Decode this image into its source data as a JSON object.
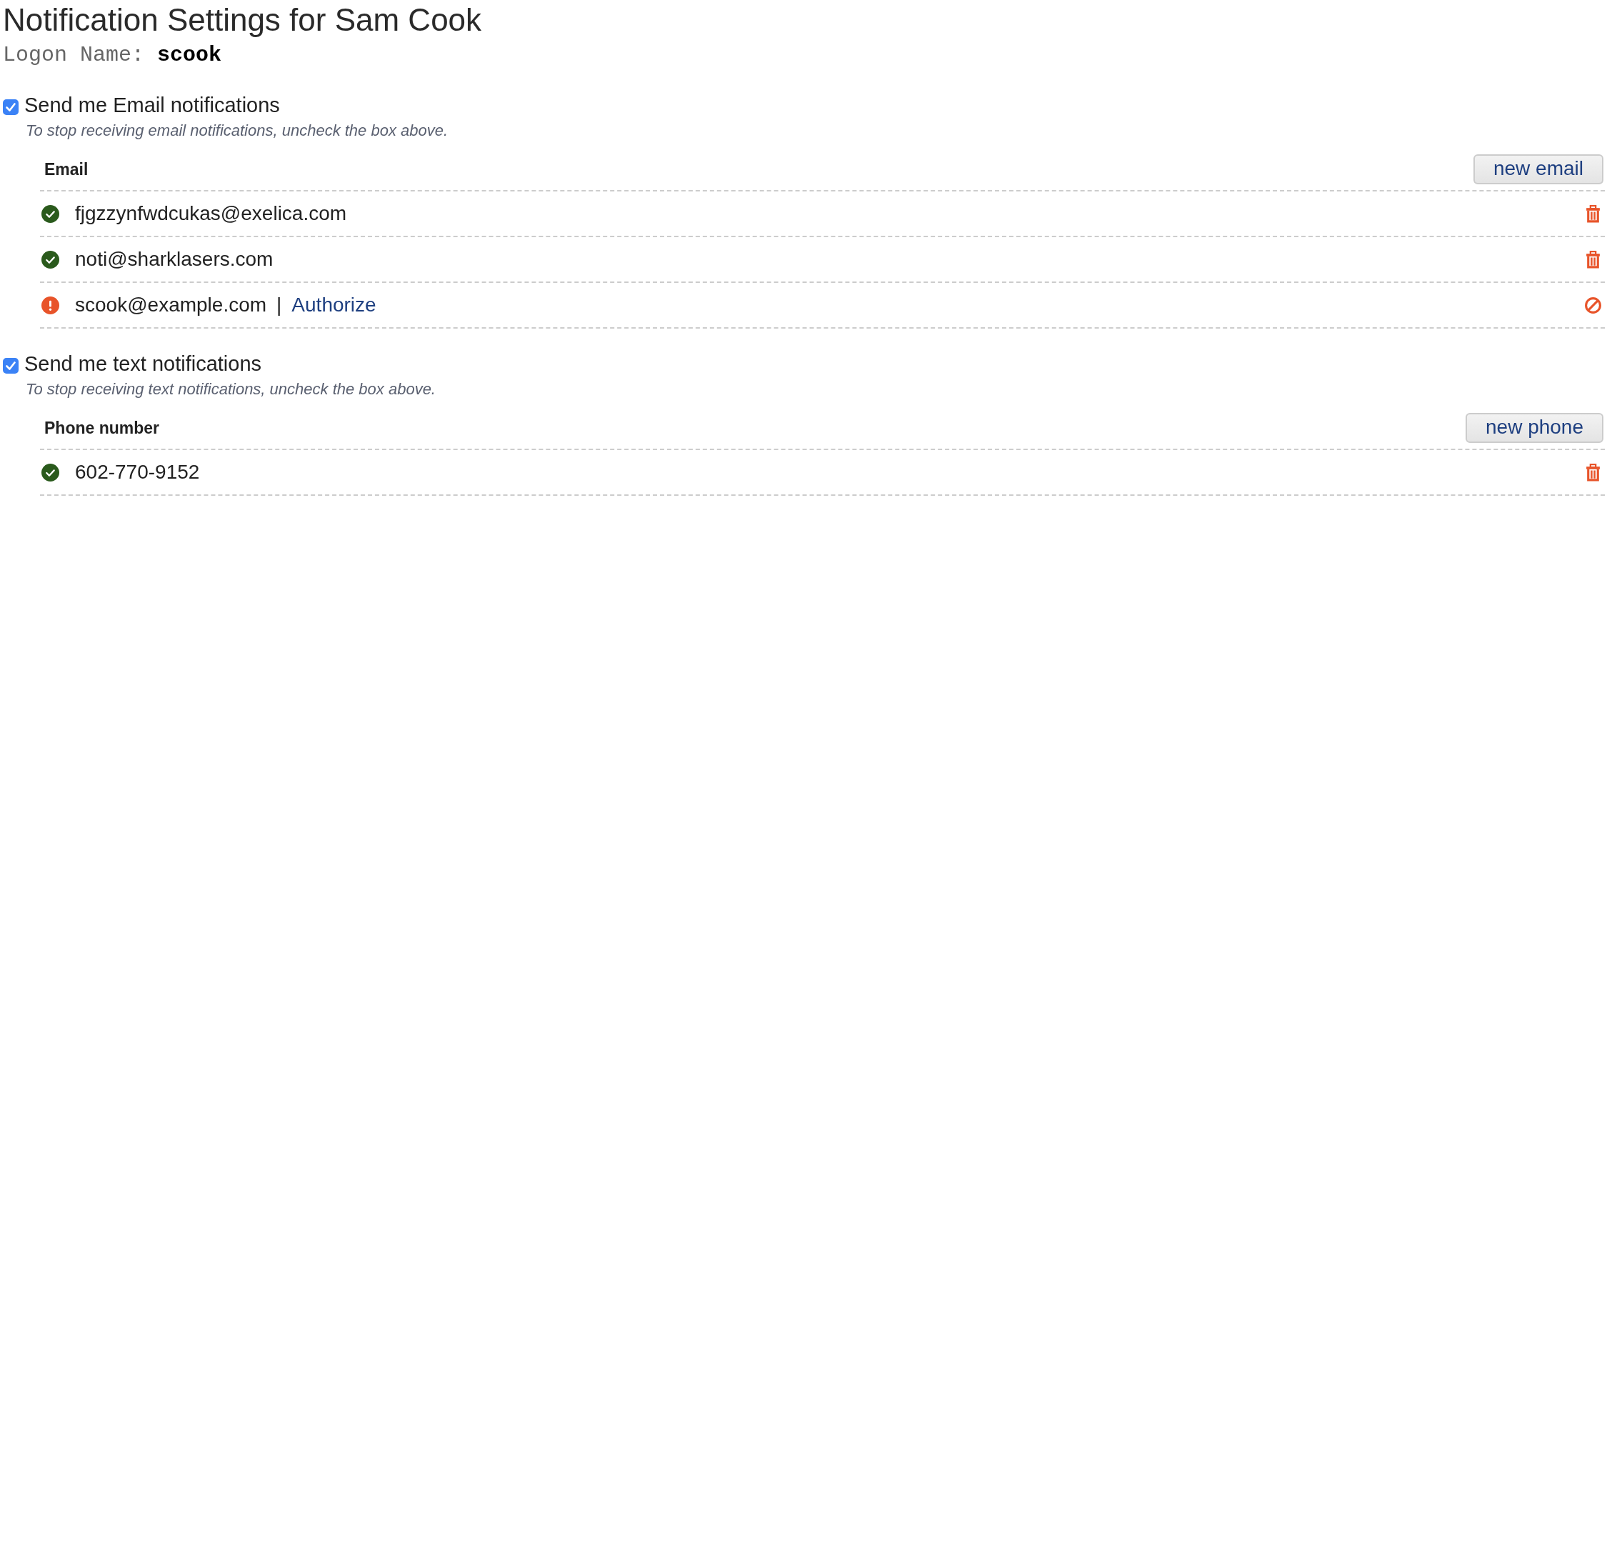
{
  "title": "Notification Settings for Sam Cook",
  "logon": {
    "label": "Logon Name:",
    "value": "scook"
  },
  "sections": [
    {
      "label": "Send me Email notifications",
      "checked": true,
      "hint": "To stop receiving email notifications, uncheck the box above.",
      "column_header": "Email",
      "button": "new email",
      "rows": [
        {
          "value": "fjgzzynfwdcukas@exelica.com",
          "verified": true
        },
        {
          "value": "noti@sharklasers.com",
          "verified": true
        },
        {
          "value": "scook@example.com",
          "verified": false,
          "separator": "|",
          "link": "Authorize"
        }
      ]
    },
    {
      "label": "Send me text notifications",
      "checked": true,
      "hint": "To stop receiving text notifications, uncheck the box above.",
      "column_header": "Phone number",
      "button": "new phone",
      "rows": [
        {
          "value": "602-770-9152",
          "verified": true
        }
      ]
    }
  ]
}
